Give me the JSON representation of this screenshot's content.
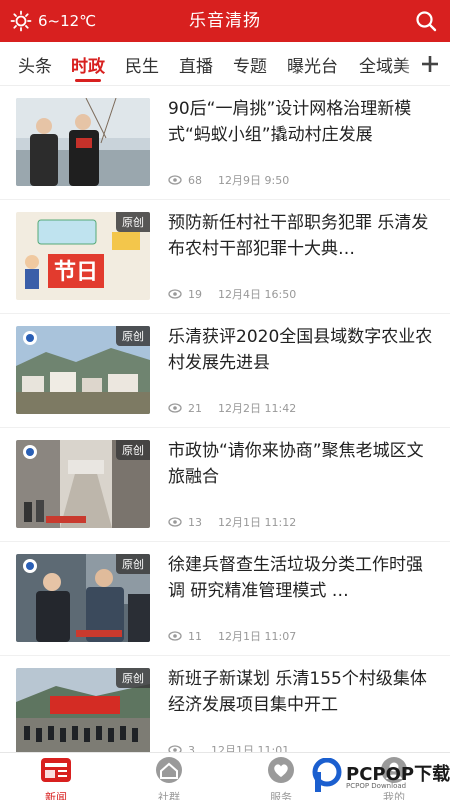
{
  "header": {
    "temperature": "6~12℃",
    "title": "乐音清扬"
  },
  "tabs": [
    {
      "label": "头条"
    },
    {
      "label": "时政"
    },
    {
      "label": "民生"
    },
    {
      "label": "直播"
    },
    {
      "label": "专题"
    },
    {
      "label": "曝光台"
    },
    {
      "label": "全域美"
    }
  ],
  "news": [
    {
      "headline": "90后“一肩挑”设计网格治理新模式“蚂蚁小组”撬动村庄发展",
      "badge": "",
      "views": "68",
      "date": "12月9日 9:50"
    },
    {
      "headline": "预防新任村社干部职务犯罪 乐清发布农村干部犯罪十大典…",
      "badge": "原创",
      "views": "19",
      "date": "12月4日 16:50"
    },
    {
      "headline": "乐清获评2020全国县域数字农业农村发展先进县",
      "badge": "原创",
      "views": "21",
      "date": "12月2日 11:42"
    },
    {
      "headline": "市政协“请你来协商”聚焦老城区文旅融合",
      "badge": "原创",
      "views": "13",
      "date": "12月1日 11:12"
    },
    {
      "headline": "徐建兵督查生活垃圾分类工作时强调 研究精准管理模式 …",
      "badge": "原创",
      "views": "11",
      "date": "12月1日 11:07"
    },
    {
      "headline": "新班子新谋划 乐清155个村级集体经济发展项目集中开工",
      "badge": "原创",
      "views": "3",
      "date": "12月1日 11:01"
    }
  ],
  "bottom_nav": [
    {
      "label": "新闻",
      "icon": "news-icon"
    },
    {
      "label": "社群",
      "icon": "community-icon"
    },
    {
      "label": "服务",
      "icon": "service-heart-icon"
    },
    {
      "label": "我的",
      "icon": "profile-icon"
    }
  ],
  "watermark": {
    "brand": "PCPOP下载",
    "sub": "PCPOP Download"
  },
  "colors": {
    "accent": "#d8201f",
    "meta": "#999999"
  }
}
